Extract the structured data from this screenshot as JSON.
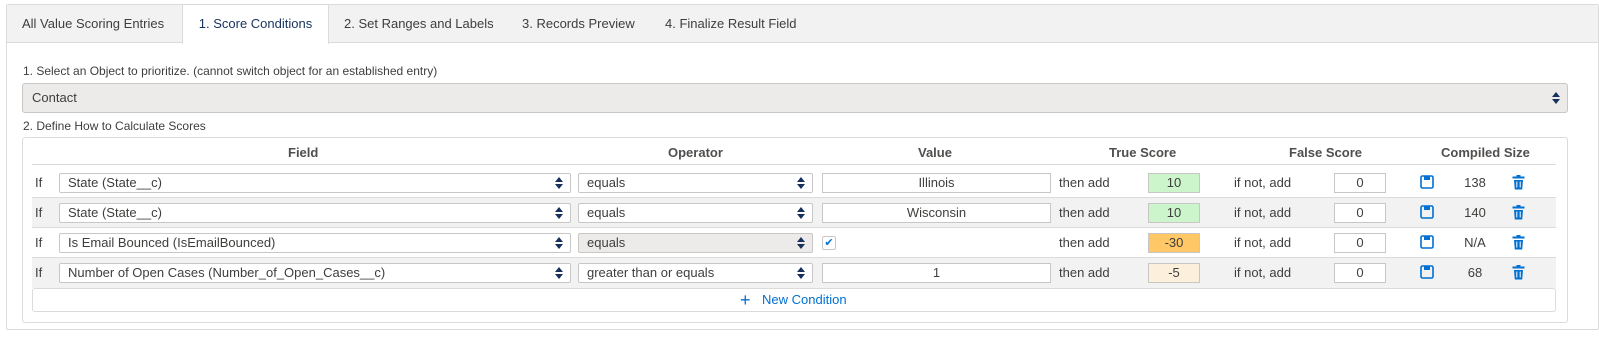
{
  "tabs": [
    {
      "label": "All Value Scoring Entries"
    },
    {
      "label": "1. Score Conditions"
    },
    {
      "label": "2. Set Ranges and Labels"
    },
    {
      "label": "3. Records Preview"
    },
    {
      "label": "4. Finalize Result Field"
    }
  ],
  "active_tab_index": 1,
  "object_step": {
    "label": "1. Select an Object to prioritize. (cannot switch object for an established entry)",
    "selected": "Contact"
  },
  "calc_step": {
    "label": "2. Define How to Calculate Scores"
  },
  "columns": {
    "field": "Field",
    "operator": "Operator",
    "value": "Value",
    "true_score": "True Score",
    "false_score": "False Score",
    "compiled_size": "Compiled Size"
  },
  "conditions": [
    {
      "if": "If",
      "field": "State (State__c)",
      "operator": "equals",
      "value": "Illinois",
      "value_is_checkbox": false,
      "then_add": "then add",
      "true_score": "10",
      "true_score_color": "#ccf5cc",
      "if_not_add": "if not, add",
      "false_score": "0",
      "compiled_size": "138"
    },
    {
      "if": "If",
      "field": "State (State__c)",
      "operator": "equals",
      "value": "Wisconsin",
      "value_is_checkbox": false,
      "then_add": "then add",
      "true_score": "10",
      "true_score_color": "#ccf5cc",
      "if_not_add": "if not, add",
      "false_score": "0",
      "compiled_size": "140"
    },
    {
      "if": "If",
      "field": "Is Email Bounced (IsEmailBounced)",
      "operator": "equals",
      "value": "✔",
      "value_is_checkbox": true,
      "then_add": "then add",
      "true_score": "-30",
      "true_score_color": "#ffc766",
      "if_not_add": "if not, add",
      "false_score": "0",
      "compiled_size": "N/A"
    },
    {
      "if": "If",
      "field": "Number of Open Cases (Number_of_Open_Cases__c)",
      "operator": "greater than or equals",
      "value": "1",
      "value_is_checkbox": false,
      "then_add": "then add",
      "true_score": "-5",
      "true_score_color": "#fcefdc",
      "if_not_add": "if not, add",
      "false_score": "0",
      "compiled_size": "68"
    }
  ],
  "new_condition_label": "New Condition",
  "icons": {
    "save": "save-icon",
    "delete": "trash-icon",
    "add": "plus-icon",
    "select": "select-arrows-icon"
  },
  "colors": {
    "accent": "#0070d2",
    "border": "#dddbda",
    "tab_bg": "#f3f2f2"
  }
}
